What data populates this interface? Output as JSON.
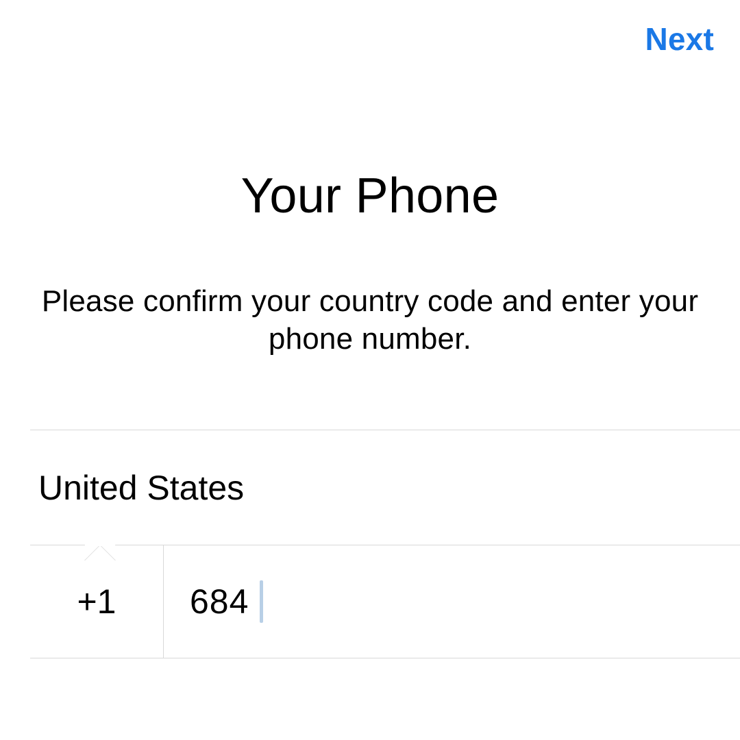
{
  "header": {
    "next_label": "Next"
  },
  "page": {
    "title": "Your Phone",
    "subtitle": "Please confirm your country code and enter your phone number."
  },
  "country": {
    "name": "United States",
    "dial_code": "+1"
  },
  "phone": {
    "value": "684"
  },
  "colors": {
    "accent": "#1a78e6",
    "divider": "#d8d8d8"
  }
}
